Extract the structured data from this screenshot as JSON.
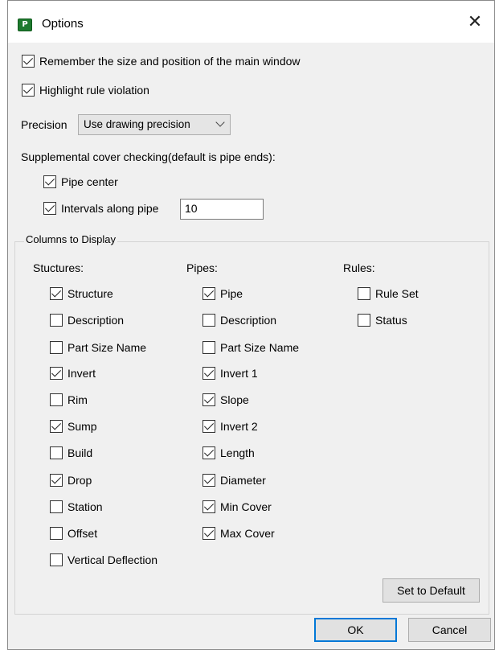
{
  "window": {
    "title": "Options",
    "app_icon_label": "P"
  },
  "general": {
    "remember_size": {
      "label": "Remember the size and position of the main window",
      "checked": true
    },
    "highlight_violation": {
      "label": "Highlight rule violation",
      "checked": true
    }
  },
  "precision": {
    "label": "Precision",
    "selected": "Use drawing precision"
  },
  "supplemental": {
    "label": "Supplemental cover checking(default is pipe ends):",
    "pipe_center": {
      "label": "Pipe center",
      "checked": true
    },
    "intervals": {
      "label": "Intervals along pipe",
      "checked": true,
      "value": "10"
    }
  },
  "columns": {
    "group_label": "Columns to Display",
    "structures": {
      "header": "Stuctures:",
      "items": [
        {
          "label": "Structure",
          "checked": true
        },
        {
          "label": "Description",
          "checked": false
        },
        {
          "label": "Part Size Name",
          "checked": false
        },
        {
          "label": "Invert",
          "checked": true
        },
        {
          "label": "Rim",
          "checked": false
        },
        {
          "label": "Sump",
          "checked": true
        },
        {
          "label": "Build",
          "checked": false
        },
        {
          "label": "Drop",
          "checked": true
        },
        {
          "label": "Station",
          "checked": false
        },
        {
          "label": "Offset",
          "checked": false
        },
        {
          "label": "Vertical Deflection",
          "checked": false
        }
      ]
    },
    "pipes": {
      "header": "Pipes:",
      "items": [
        {
          "label": "Pipe",
          "checked": true
        },
        {
          "label": "Description",
          "checked": false
        },
        {
          "label": "Part Size Name",
          "checked": false
        },
        {
          "label": "Invert 1",
          "checked": true
        },
        {
          "label": "Slope",
          "checked": true
        },
        {
          "label": "Invert 2",
          "checked": true
        },
        {
          "label": "Length",
          "checked": true
        },
        {
          "label": "Diameter",
          "checked": true
        },
        {
          "label": "Min Cover",
          "checked": true
        },
        {
          "label": "Max Cover",
          "checked": true
        }
      ]
    },
    "rules": {
      "header": "Rules:",
      "items": [
        {
          "label": "Rule Set",
          "checked": false
        },
        {
          "label": "Status",
          "checked": false
        }
      ]
    }
  },
  "buttons": {
    "set_default": "Set to Default",
    "ok": "OK",
    "cancel": "Cancel"
  }
}
